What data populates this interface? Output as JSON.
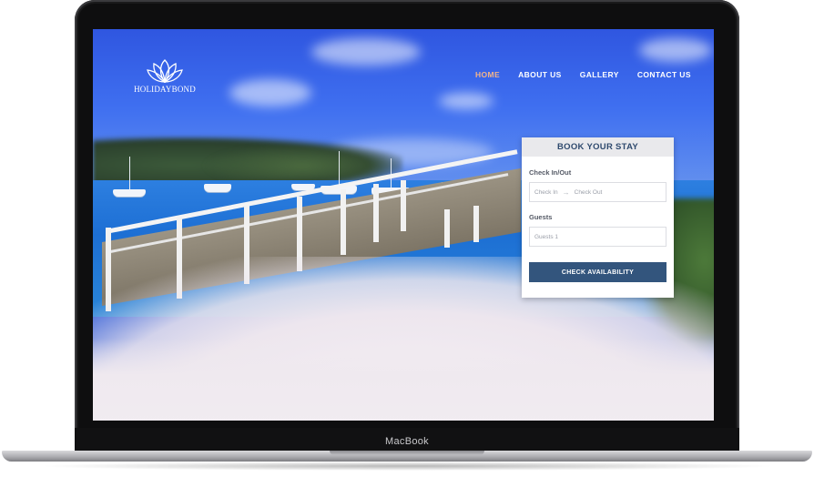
{
  "device": {
    "brand_label": "MacBook"
  },
  "site": {
    "logo_text": "HOLIDAYBOND",
    "nav": [
      {
        "label": "HOME",
        "active": true
      },
      {
        "label": "ABOUT US",
        "active": false
      },
      {
        "label": "GALLERY",
        "active": false
      },
      {
        "label": "CONTACT US",
        "active": false
      }
    ]
  },
  "booking": {
    "title": "BOOK YOUR STAY",
    "checkin_label": "Check In/Out",
    "checkin_placeholder": "Check In",
    "checkout_placeholder": "Check Out",
    "guests_label": "Guests",
    "guests_value": "Guests 1",
    "button_label": "CHECK AVAILABILITY"
  },
  "colors": {
    "accent_nav_active": "#f2b48a",
    "button": "#33557d",
    "widget_title": "#2f4a6e"
  },
  "icons": [
    "lotus-logo-icon",
    "arrow-right-icon"
  ]
}
